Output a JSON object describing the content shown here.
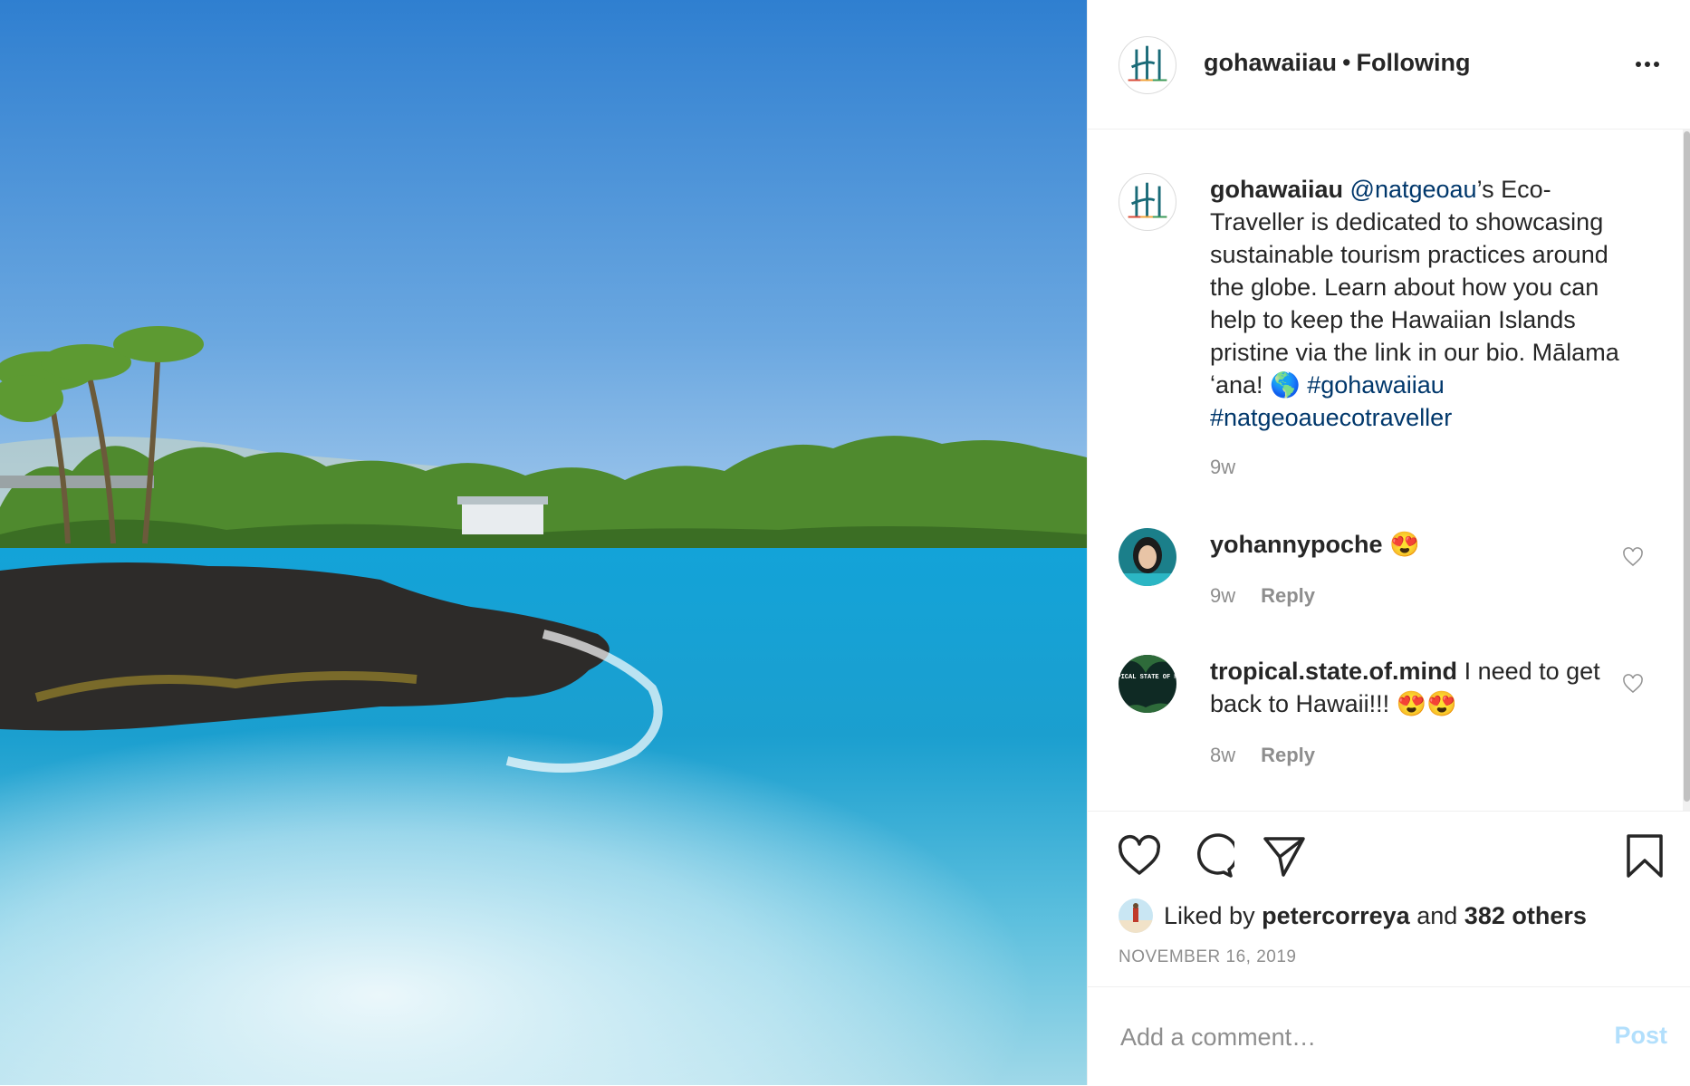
{
  "header": {
    "username": "gohawaiiau",
    "separator": "•",
    "follow_status": "Following"
  },
  "caption": {
    "username": "gohawaiiau",
    "mention": "@natgeoau",
    "text": "’s Eco-Traveller is dedicated to showcasing sustainable tourism practices around the globe. Learn about how you can help to keep the Hawaiian Islands pristine via the link in our bio. Mālama ʻana! 🌎",
    "hashtag1": "#gohawaiiau",
    "hashtag2": "#natgeoauecotraveller",
    "time": "9w"
  },
  "comments": [
    {
      "username": "yohannypoche",
      "text": "😍",
      "time": "9w",
      "reply_label": "Reply"
    },
    {
      "username": "tropical.state.of.mind",
      "text": "I need to get back to Hawaii!!! 😍😍",
      "time": "8w",
      "reply_label": "Reply",
      "avatar_text": "TROPICAL STATE OF MIND"
    }
  ],
  "likes": {
    "prefix": "Liked by",
    "user": "petercorreya",
    "conjunction": "and",
    "others": "382 others"
  },
  "date": "NOVEMBER 16, 2019",
  "comment_box": {
    "placeholder": "Add a comment…",
    "post_label": "Post"
  },
  "colors": {
    "link": "#00376b",
    "muted": "#8e8e8e",
    "post_disabled": "#b2dffc"
  },
  "icons": [
    "more-options-icon",
    "like-icon",
    "comment-icon",
    "share-icon",
    "save-icon",
    "heart-small-icon"
  ]
}
